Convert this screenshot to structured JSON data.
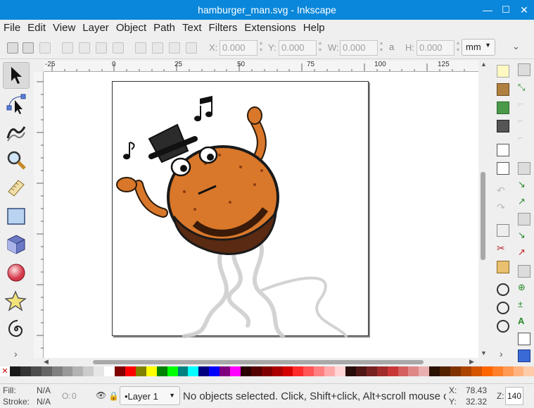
{
  "window": {
    "title": "hamburger_man.svg - Inkscape",
    "minimize": "—",
    "maximize": "☐",
    "close": "✕"
  },
  "menu": [
    "File",
    "Edit",
    "View",
    "Layer",
    "Object",
    "Path",
    "Text",
    "Filters",
    "Extensions",
    "Help"
  ],
  "toolbar": {
    "x_label": "X:",
    "x_value": "0.000",
    "y_label": "Y:",
    "y_value": "0.000",
    "w_label": "W:",
    "w_value": "0.000",
    "h_label": "H:",
    "h_value": "0.000",
    "units": "mm",
    "overflow": "⌄"
  },
  "ruler": {
    "ticks": [
      "-25",
      "0",
      "25",
      "50",
      "75",
      "100",
      "125"
    ]
  },
  "tools": [
    {
      "name": "selector-tool-icon",
      "active": true
    },
    {
      "name": "node-tool-icon"
    },
    {
      "name": "tweak-tool-icon"
    },
    {
      "name": "zoom-tool-icon"
    },
    {
      "name": "measure-tool-icon"
    },
    {
      "name": "rectangle-tool-icon"
    },
    {
      "name": "3d-box-tool-icon"
    },
    {
      "name": "ellipse-tool-icon"
    },
    {
      "name": "star-tool-icon"
    },
    {
      "name": "spiral-tool-icon"
    }
  ],
  "tools_more": "›",
  "commands_more": "›",
  "status": {
    "fill_label": "Fill:",
    "fill_value": "N/A",
    "stroke_label": "Stroke:",
    "stroke_value": "N/A",
    "opacity_label": "O:",
    "opacity_value": "0",
    "layer": "•Layer 1",
    "message": "No objects selected. Click, Shift+click, Alt+scroll mouse on top of objects, or drag around objects to select.",
    "x_label": "X:",
    "x_value": "78.43",
    "y_label": "Y:",
    "y_value": "32.32",
    "zoom_label": "Z:",
    "zoom_value": "140"
  },
  "palette": [
    "#1a1a1a",
    "#333333",
    "#4d4d4d",
    "#666666",
    "#808080",
    "#999999",
    "#b3b3b3",
    "#cccccc",
    "#e6e6e6",
    "#ffffff",
    "#800000",
    "#ff0000",
    "#808000",
    "#ffff00",
    "#008000",
    "#00ff00",
    "#008080",
    "#00ffff",
    "#000080",
    "#0000ff",
    "#800080",
    "#ff00ff",
    "#2b0000",
    "#550000",
    "#800000",
    "#aa0000",
    "#d40000",
    "#ff2a2a",
    "#ff5555",
    "#ff8080",
    "#ffaaaa",
    "#ffd5d5",
    "#280b0b",
    "#501616",
    "#782121",
    "#a02c2c",
    "#c83737",
    "#d35f5f",
    "#de8787",
    "#e9afaf",
    "#2b1100",
    "#552200",
    "#803300",
    "#aa4400",
    "#d45500",
    "#ff6600",
    "#ff7f2a",
    "#ff9955",
    "#ffb380",
    "#ffccaa"
  ]
}
